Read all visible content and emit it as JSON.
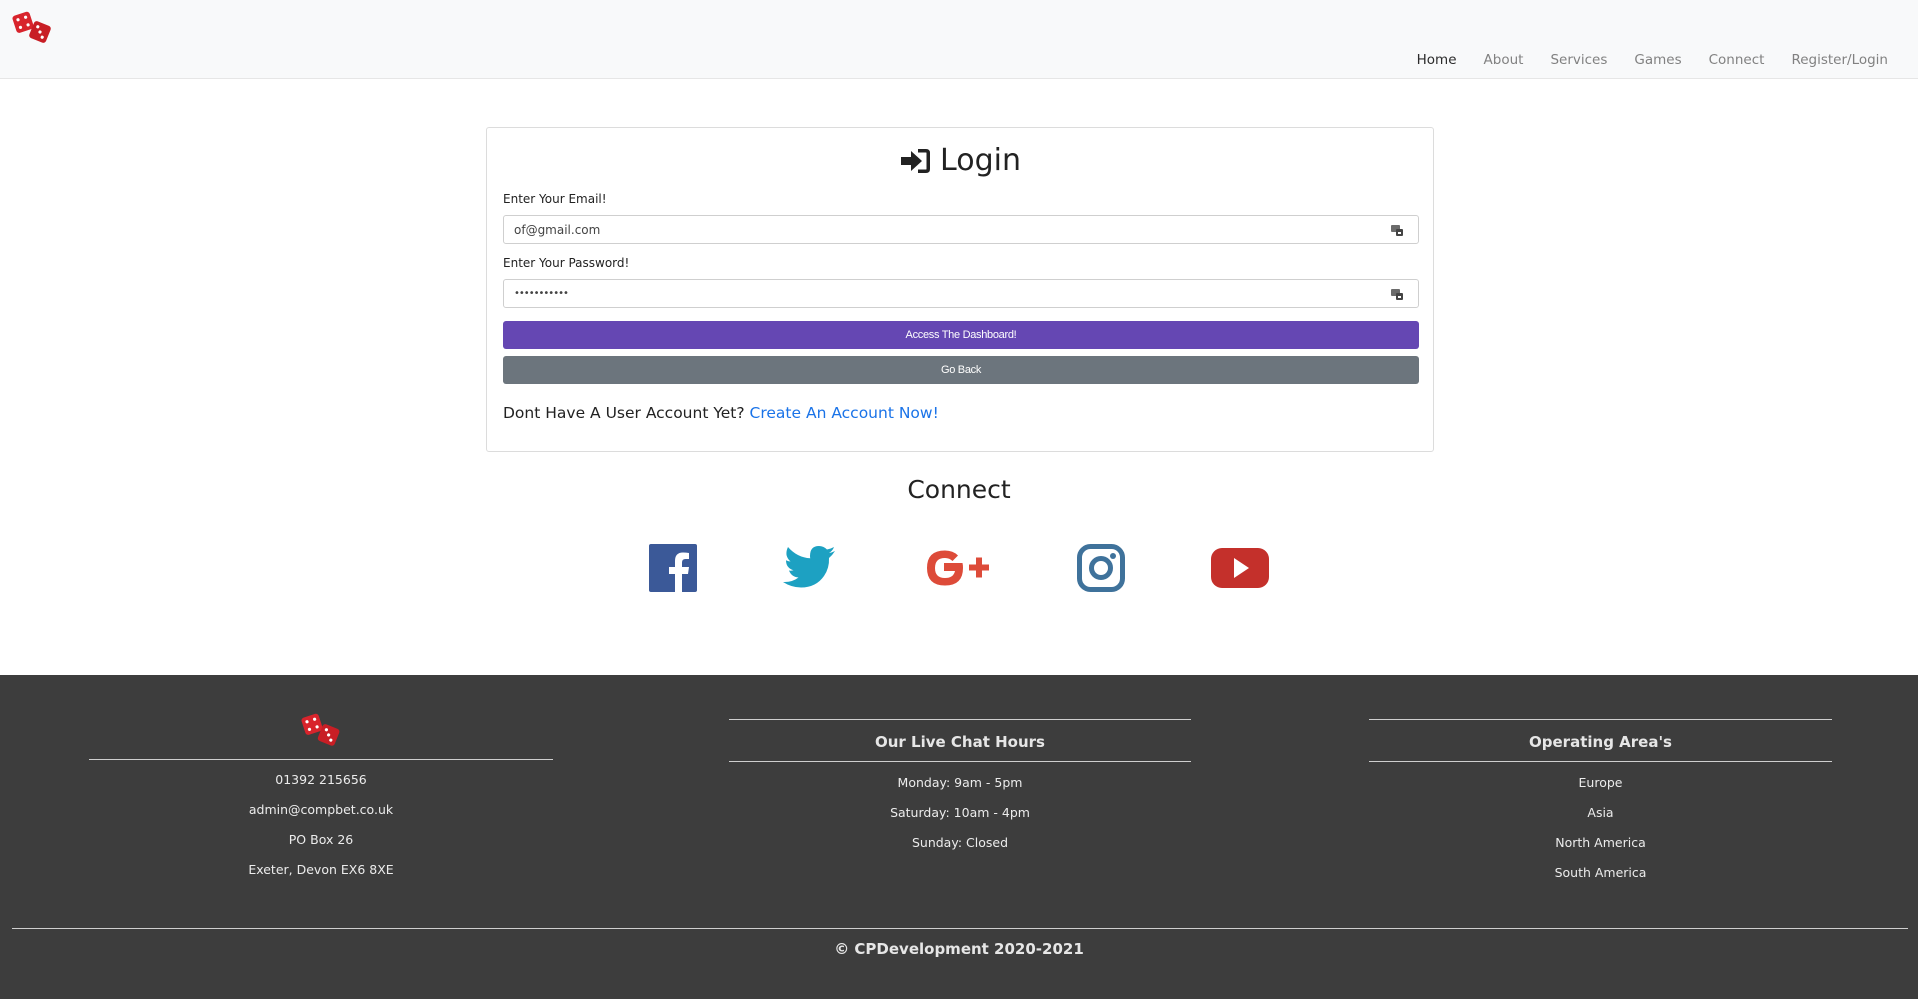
{
  "nav": {
    "items": [
      "Home",
      "About",
      "Services",
      "Games",
      "Connect",
      "Register/Login"
    ]
  },
  "login": {
    "title": "Login",
    "email_label": "Enter Your Email!",
    "email_value": "of@gmail.com",
    "password_label": "Enter Your Password!",
    "password_value": "•••••••••••",
    "submit_label": "Access The Dashboard!",
    "back_label": "Go Back",
    "signup_prompt": "Dont Have A User Account Yet?",
    "signup_link": "Create An Account Now!"
  },
  "connect": {
    "title": "Connect",
    "icons": [
      "facebook-icon",
      "twitter-icon",
      "google-plus-icon",
      "instagram-icon",
      "youtube-icon"
    ]
  },
  "footer": {
    "contact": [
      "01392 215656",
      "admin@compbet.co.uk",
      "PO Box 26",
      "Exeter, Devon EX6 8XE"
    ],
    "hours_title": "Our Live Chat Hours",
    "hours": [
      "Monday: 9am - 5pm",
      "Saturday: 10am - 4pm",
      "Sunday: Closed"
    ],
    "areas_title": "Operating Area's",
    "areas": [
      "Europe",
      "Asia",
      "North America",
      "South America"
    ],
    "copyright": "© CPDevelopment 2020-2021"
  },
  "colors": {
    "primary_button": "#6547b3",
    "secondary_button": "#6c757d",
    "link": "#1a73e8",
    "footer_bg": "#3d3d3d",
    "facebook": "#3b5998",
    "twitter": "#1da1c2",
    "google_plus": "#dd4b39",
    "instagram": "#3f729b",
    "youtube": "#c4302b"
  }
}
